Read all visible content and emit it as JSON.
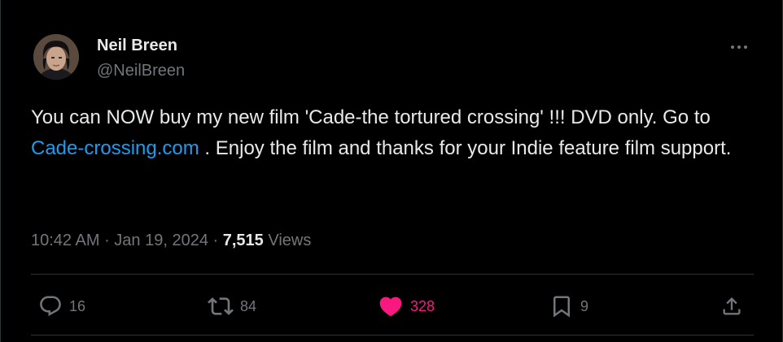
{
  "author": {
    "name": "Neil Breen",
    "handle": "@NeilBreen"
  },
  "tweet": {
    "text_part1": "You can NOW buy my new film 'Cade-the tortured crossing' !!! DVD only. Go to ",
    "link_text": "Cade-crossing.com",
    "text_part2": " . Enjoy the film and thanks for your Indie feature film support."
  },
  "meta": {
    "time": "10:42 AM",
    "separator1": " · ",
    "date": "Jan 19, 2024",
    "separator2": " · ",
    "views_count": "7,515",
    "views_label": " Views"
  },
  "actions": {
    "replies": "16",
    "reposts": "84",
    "likes": "328",
    "bookmarks": "9"
  },
  "icons": {
    "reply": "reply-icon",
    "repost": "repost-icon",
    "like": "heart-icon",
    "bookmark": "bookmark-icon",
    "share": "share-icon",
    "more": "more-icon"
  },
  "colors": {
    "background": "#000000",
    "text": "#e7e9ea",
    "muted": "#71767b",
    "link": "#1d9bf0",
    "like": "#f91880",
    "divider": "#2f3336"
  }
}
